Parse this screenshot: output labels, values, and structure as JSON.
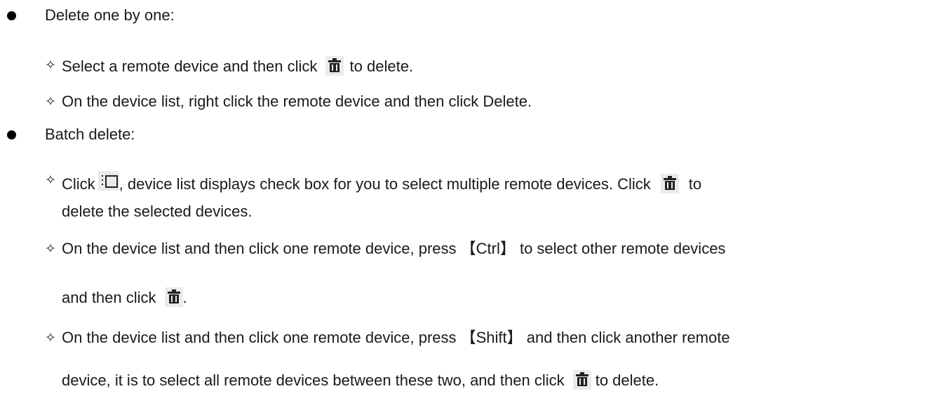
{
  "doc": {
    "section1": {
      "title": "Delete one by one:"
    },
    "item1": {
      "text_before": "Select a remote device and then click",
      "text_after": " to delete."
    },
    "item2": {
      "text": "On the device list, right click the remote device and then click Delete."
    },
    "section2": {
      "title": "Batch delete:"
    },
    "item3": {
      "text_start": "Click",
      "text_mid": ", device list displays check box for you to select multiple remote devices. Click",
      "text_end": "to",
      "text_line2": "delete the selected devices."
    },
    "item4": {
      "text_line1": "On the device list and then click one remote device, press 【Ctrl】 to select other remote devices",
      "text_line2": "and then click",
      "text_after": "."
    },
    "item5": {
      "text_line1": "On the device list and then click one remote device, press 【Shift】 and then click another remote",
      "text_line2": "device, it is to select all remote devices between these two, and then click",
      "text_after": " to delete."
    },
    "icons": {
      "delete": "trash-icon",
      "multi_select": "list-checkbox-icon"
    },
    "bullet_glyph": "✧"
  }
}
